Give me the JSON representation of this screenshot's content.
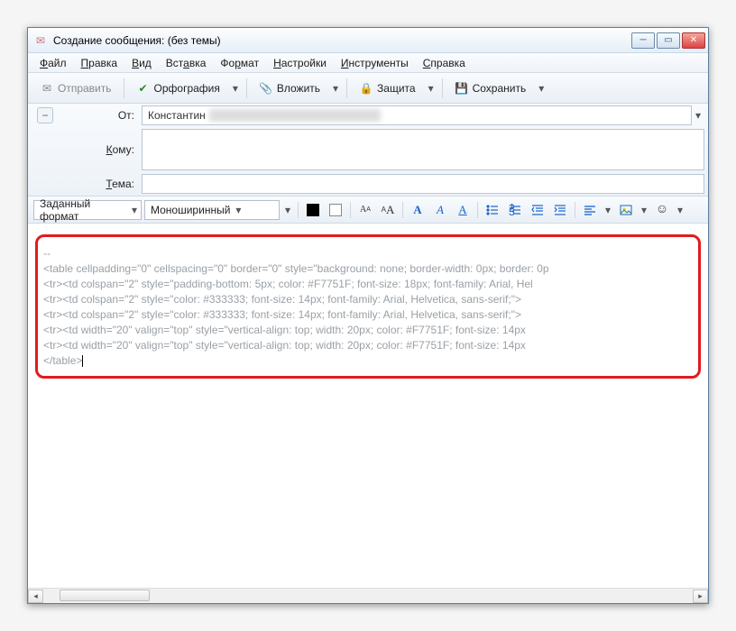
{
  "window": {
    "title": "Создание сообщения: (без темы)"
  },
  "menu": {
    "file": "Файл",
    "edit": "Правка",
    "view": "Вид",
    "insert": "Вставка",
    "format": "Формат",
    "settings": "Настройки",
    "tools": "Инструменты",
    "help": "Справка"
  },
  "toolbar": {
    "send": "Отправить",
    "spelling": "Орфография",
    "attach": "Вложить",
    "security": "Защита",
    "save": "Сохранить"
  },
  "headers": {
    "from_label": "От:",
    "from_value": "Константин",
    "to_label": "Кому:",
    "to_value": "",
    "subject_label": "Тема:",
    "subject_value": ""
  },
  "format": {
    "para": "Заданный формат",
    "font": "Моноширинный"
  },
  "content": {
    "l1": "--",
    "l2": "<table cellpadding=\"0\" cellspacing=\"0\" border=\"0\" style=\"background: none; border-width: 0px; border: 0p",
    "l3": "<tr><td colspan=\"2\" style=\"padding-bottom: 5px; color: #F7751F; font-size: 18px; font-family: Arial, Hel",
    "l4": "<tr><td colspan=\"2\" style=\"color: #333333; font-size: 14px; font-family: Arial, Helvetica, sans-serif;\">",
    "l5": "<tr><td colspan=\"2\" style=\"color: #333333; font-size: 14px; font-family: Arial, Helvetica, sans-serif;\">",
    "l6": "<tr><td width=\"20\" valign=\"top\" style=\"vertical-align: top; width: 20px; color: #F7751F; font-size: 14px",
    "l7": "<tr><td width=\"20\" valign=\"top\" style=\"vertical-align: top; width: 20px; color: #F7751F; font-size: 14px",
    "l8": "</table>"
  }
}
